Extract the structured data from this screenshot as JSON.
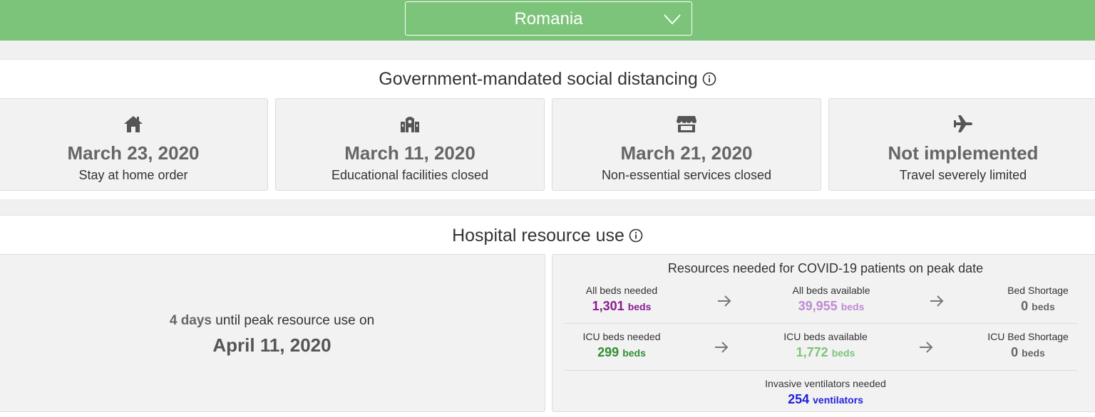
{
  "header": {
    "country": "Romania",
    "dropdown_icon": "chevron-down-icon",
    "background_color": "#7cc47a"
  },
  "social_distancing": {
    "title": "Government-mandated social distancing",
    "info_icon": "info-icon",
    "measures": [
      {
        "icon": "home-icon",
        "value": "March 23, 2020",
        "label": "Stay at home order"
      },
      {
        "icon": "school-icon",
        "value": "March 11, 2020",
        "label": "Educational facilities closed"
      },
      {
        "icon": "store-icon",
        "value": "March 21, 2020",
        "label": "Non-essential services closed"
      },
      {
        "icon": "airplane-icon",
        "value": "Not implemented",
        "label": "Travel severely limited"
      }
    ]
  },
  "hospital": {
    "title": "Hospital resource use",
    "info_icon": "info-icon",
    "peak": {
      "days": "4 days",
      "text": "until peak resource use on",
      "date": "April 11, 2020"
    },
    "resources": {
      "title": "Resources needed for COVID-19 patients on peak date",
      "all_beds_needed": {
        "label": "All beds needed",
        "value": "1,301",
        "unit": "beds"
      },
      "all_beds_available": {
        "label": "All beds available",
        "value": "39,955",
        "unit": "beds"
      },
      "bed_shortage": {
        "label": "Bed Shortage",
        "value": "0",
        "unit": "beds"
      },
      "icu_beds_needed": {
        "label": "ICU beds needed",
        "value": "299",
        "unit": "beds"
      },
      "icu_beds_available": {
        "label": "ICU beds available",
        "value": "1,772",
        "unit": "beds"
      },
      "icu_bed_shortage": {
        "label": "ICU Bed Shortage",
        "value": "0",
        "unit": "beds"
      },
      "ventilators_needed": {
        "label": "Invasive ventilators needed",
        "value": "254",
        "unit": "ventilators"
      }
    },
    "colors": {
      "beds_needed": "#8a1c8f",
      "beds_available": "#bf8ad1",
      "icu_needed": "#2f8f2f",
      "icu_available": "#7cc47a",
      "ventilators": "#2222dd"
    }
  }
}
